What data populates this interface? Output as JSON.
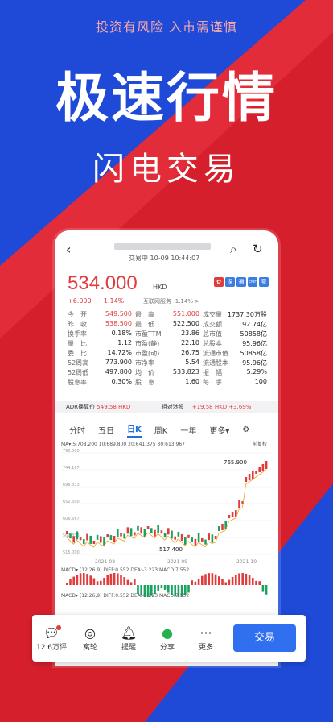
{
  "disclaimer": "投资有风险 入市需谨慎",
  "headline": "极速行情",
  "subheadline": "闪电交易",
  "colors": {
    "accent_red": "#e13b3b",
    "accent_blue": "#2f6ff0",
    "bg_red": "#d61f2c",
    "bg_blue": "#1f4ad8"
  },
  "quote": {
    "state": "交易中  10-09 10:44:07",
    "price": "534.000",
    "currency": "HKD",
    "change": "+6.000",
    "change_pct": "+1.14%",
    "link_text": "互联网服务 -1.14% >",
    "flags": [
      "深",
      "通",
      "EMF",
      "竞"
    ]
  },
  "stats": [
    [
      [
        "今　开",
        "549.500"
      ],
      [
        "最　高",
        "551.000"
      ],
      [
        "成交量",
        "1737.30万股"
      ]
    ],
    [
      [
        "昨　收",
        "538.500"
      ],
      [
        "最　低",
        "522.500"
      ],
      [
        "成交额",
        "92.74亿"
      ]
    ],
    [
      [
        "换手率",
        "0.18%"
      ],
      [
        "市盈TTM",
        "23.86"
      ],
      [
        "总市值",
        "50858亿"
      ]
    ],
    [
      [
        "量　比",
        "1.12"
      ],
      [
        "市盈(静)",
        "22.10"
      ],
      [
        "总股本",
        "95.96亿"
      ]
    ],
    [
      [
        "委　比",
        "14.72%"
      ],
      [
        "市盈(动)",
        "26.75"
      ],
      [
        "流通市值",
        "50858亿"
      ]
    ],
    [
      [
        "52周高",
        "773.900"
      ],
      [
        "市净率",
        "5.54"
      ],
      [
        "流通股本",
        "95.96亿"
      ]
    ],
    [
      [
        "52周低",
        "497.800"
      ],
      [
        "均　价",
        "533.823"
      ],
      [
        "振　幅",
        "5.29%"
      ]
    ],
    [
      [
        "股息率",
        "0.30%"
      ],
      [
        "股　息",
        "1.60"
      ],
      [
        "每　手",
        "100"
      ]
    ]
  ],
  "adr": {
    "label": "ADR换算价",
    "value": "549.58 HKD",
    "rel_label": "相对港股",
    "rel_value": "+19.58 HKD  +3.69%"
  },
  "tabs": [
    "分时",
    "五日",
    "日K",
    "周K",
    "一年",
    "更多▾"
  ],
  "chart": {
    "ma_line": "MA▾  5:708.200  10:689.800  20:641.375  30:613.967",
    "restore": "前复权",
    "ticks": [
      "790.000",
      "744.167",
      "698.333",
      "652.500",
      "606.667",
      "560.833",
      "515.000"
    ],
    "high_label": "765.900",
    "low_label": "517.400",
    "dates": [
      "2021-08",
      "2021-09",
      "2021-10"
    ],
    "macd1": "MACD▾ (12,26,9)  DIFF:0.552  DEA:-3.223  MACD:7.552",
    "macd2": "MACD▾ (12,26,9)  DIFF:0.552  DEA:-3.223  MACD:7.552"
  },
  "bottombar": {
    "items": [
      {
        "icon": "comment-icon",
        "label": "12.6万评"
      },
      {
        "icon": "wheel-icon",
        "label": "窝轮"
      },
      {
        "icon": "bell-icon",
        "label": "提醒"
      },
      {
        "icon": "wechat-icon",
        "label": "分享"
      },
      {
        "icon": "more-icon",
        "label": "更多"
      }
    ],
    "trade": "交易"
  }
}
